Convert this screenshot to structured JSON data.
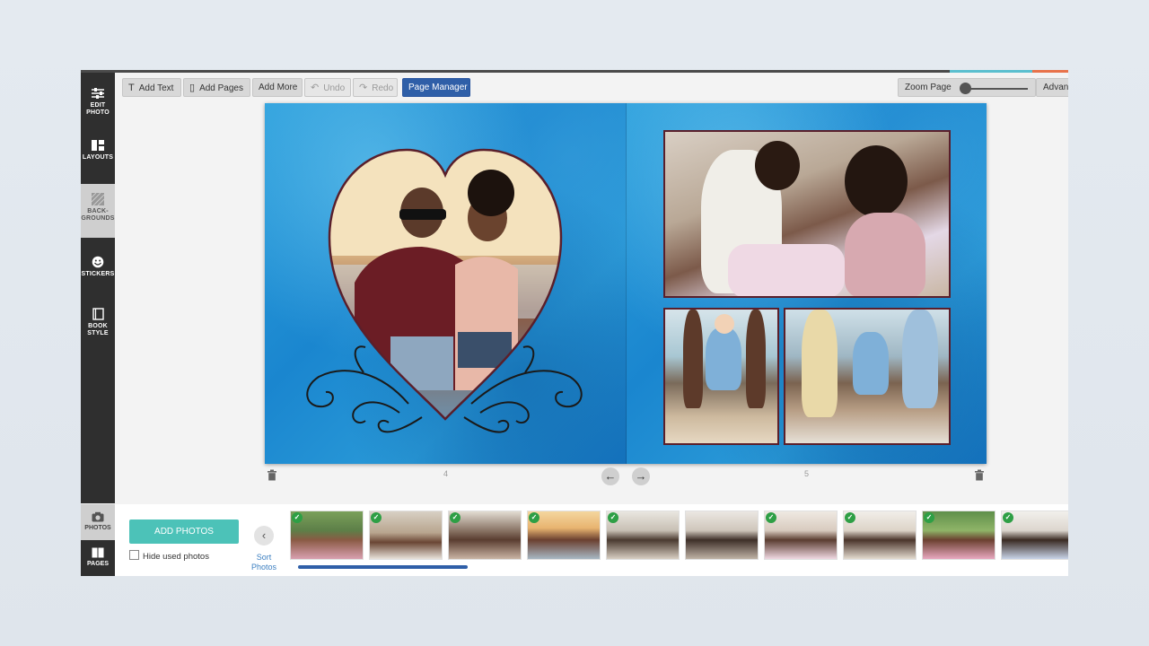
{
  "toolbar": {
    "add_text": "Add Text",
    "add_pages": "Add Pages",
    "add_more": "Add More",
    "undo": "Undo",
    "redo": "Redo",
    "page_manager": "Page Manager",
    "zoom_label": "Zoom Page",
    "advanced": "Advan"
  },
  "sidebar": {
    "items": [
      {
        "label": "EDIT PHOTO",
        "icon": "sliders-icon"
      },
      {
        "label": "LAYOUTS",
        "icon": "layout-grid-icon"
      },
      {
        "label": "BACK-GROUNDS",
        "icon": "backgrounds-icon",
        "active": true
      },
      {
        "label": "STICKERS",
        "icon": "smiley-icon"
      },
      {
        "label": "BOOK STYLE",
        "icon": "book-icon"
      }
    ]
  },
  "spread": {
    "left_page_number": "4",
    "right_page_number": "5"
  },
  "bottom": {
    "tab_photos": "PHOTOS",
    "tab_pages": "PAGES",
    "add_photos": "ADD PHOTOS",
    "hide_used": "Hide used photos",
    "sort_photos": "Sort Photos",
    "thumbnail_count": 10
  },
  "colors": {
    "primary_button": "#2f5fa8",
    "add_photos_button": "#4cc2b8",
    "photo_frame": "#5a1f2b",
    "check_badge": "#2e9f45",
    "page_background": "#1f8fd4"
  }
}
